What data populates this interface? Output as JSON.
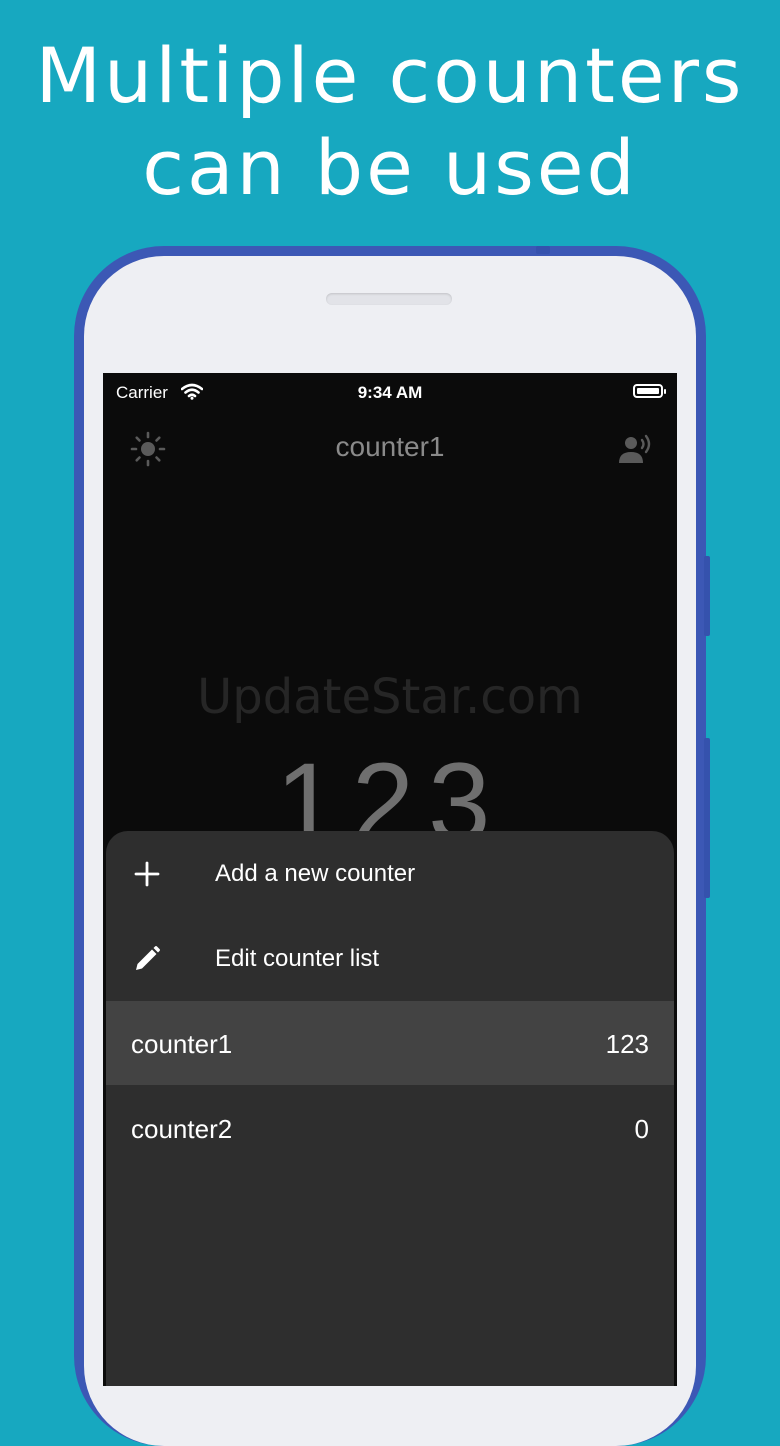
{
  "headline": {
    "line1": "Multiple counters",
    "line2": "can be used"
  },
  "status_bar": {
    "carrier": "Carrier",
    "time": "9:34 AM"
  },
  "nav": {
    "title": "counter1",
    "left_icon": "sun-icon",
    "right_icon": "voice-icon"
  },
  "watermark": "UpdateStar.com",
  "main_count": "123",
  "menu": {
    "add_label": "Add a new counter",
    "edit_label": "Edit counter list"
  },
  "counters": [
    {
      "name": "counter1",
      "value": "123",
      "selected": true
    },
    {
      "name": "counter2",
      "value": "0",
      "selected": false
    }
  ],
  "colors": {
    "background": "#17a8c0",
    "phone_frame": "#3c58b5",
    "screen": "#0b0b0b",
    "sheet": "#2e2e2e",
    "selected_row": "#434343"
  }
}
